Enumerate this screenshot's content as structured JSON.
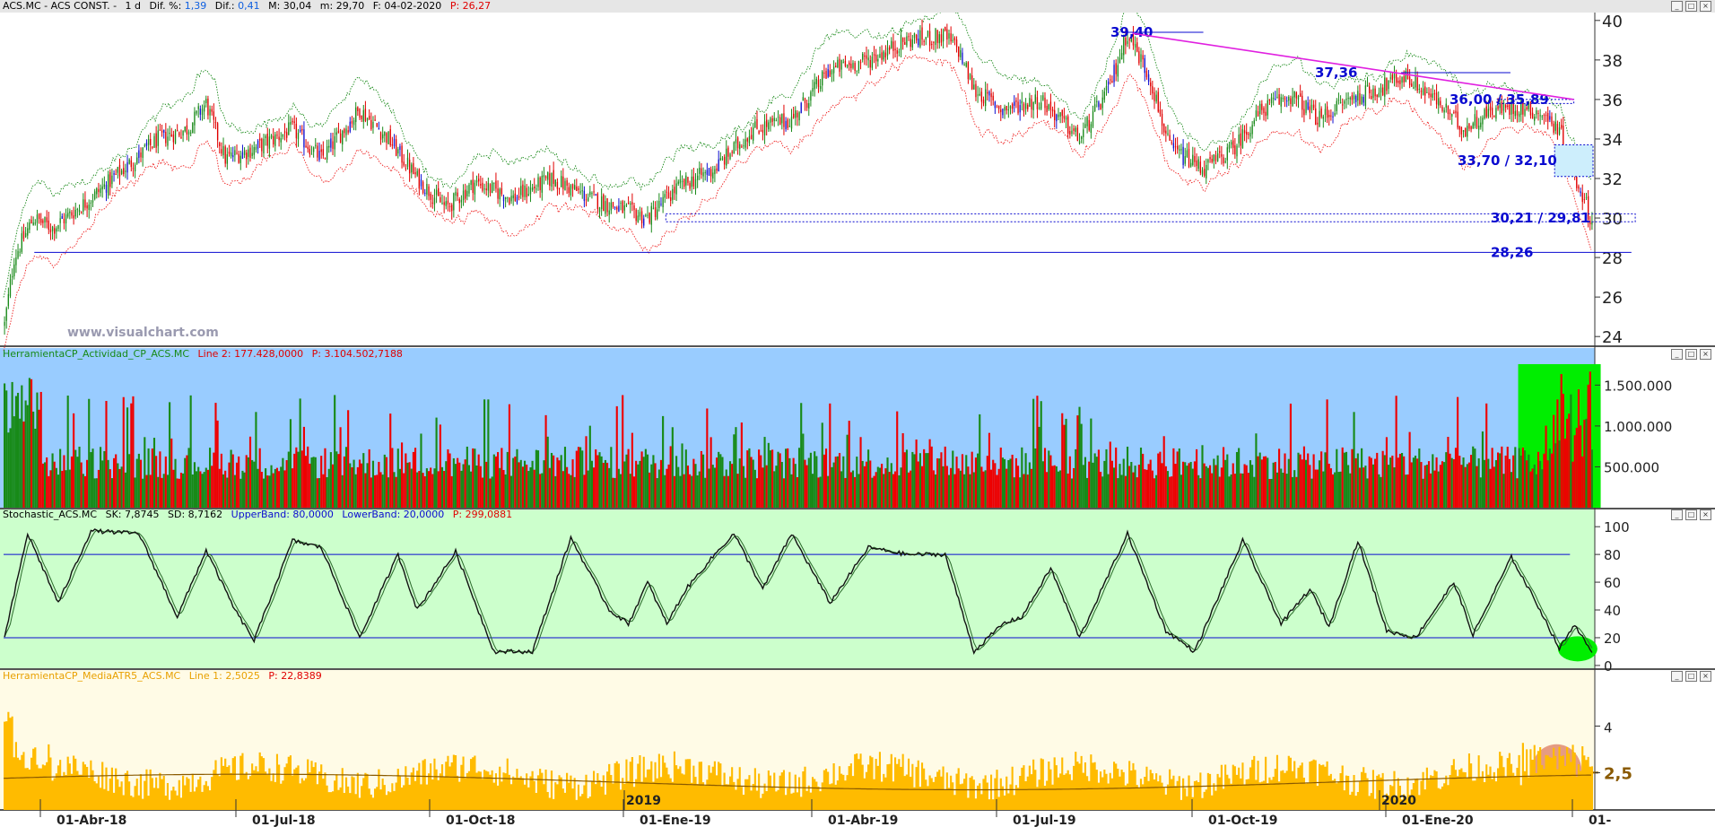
{
  "colors": {
    "bull": "#1a8a1a",
    "bear": "#e00000",
    "blue_candle": "#1010d0",
    "upper_band": "#1a8a1a",
    "lower_band": "#ee2020",
    "trendline": "#e020e0",
    "level": "#0a0ad0",
    "vol_bg": "#99ccff",
    "vol_green": "#178a17",
    "vol_red": "#ee0000",
    "highlight_green": "#00ee00",
    "stoch_bg": "#ccffcc",
    "atr_bg": "#fffbe6",
    "atr_fill": "#ffbb00"
  },
  "price_panel": {
    "header": {
      "symbol": "ACS.MC - ACS CONST. -",
      "period": "1 d",
      "dif_pct_label": "Dif. %:",
      "dif_pct": "1,39",
      "dif_label": "Dif.:",
      "dif": "0,41",
      "m": "M: 30,04",
      "mn": "m: 29,70",
      "f": "F: 04-02-2020",
      "p": "P: 26,27"
    },
    "watermark": "www.visualchart.com",
    "annotations": [
      {
        "id": "level-3940",
        "text": "39,40"
      },
      {
        "id": "level-3736",
        "text": "37,36"
      },
      {
        "id": "level-3600",
        "text": "36,00 / 35,89"
      },
      {
        "id": "level-3370",
        "text": "33,70 / 32,10"
      },
      {
        "id": "level-3021",
        "text": "30,21 / 29,81"
      },
      {
        "id": "level-2826",
        "text": "28,26"
      }
    ]
  },
  "volume_panel": {
    "header": {
      "name": "HerramientaCP_Actividad_CP_ACS.MC",
      "line": "Line 2: 177.428,0000",
      "p": "P: 3.104.502,7188"
    }
  },
  "stoch_panel": {
    "header": {
      "name": "Stochastic_ACS.MC",
      "sk": "SK: 7,8745",
      "sd": "SD: 8,7162",
      "upper": "UpperBand: 80,0000",
      "lower": "LowerBand: 20,0000",
      "p": "P: 299,0881"
    }
  },
  "atr_panel": {
    "header": {
      "name": "HerramientaCP_MediaATR5_ACS.MC",
      "line": "Line 1: 2,5025",
      "p": "P: 22,8389"
    }
  },
  "xaxis": {
    "labels": [
      "01-Abr-18",
      "01-Jul-18",
      "01-Oct-18",
      "01-Ene-19",
      "01-Abr-19",
      "01-Jul-19",
      "01-Oct-19",
      "01-Ene-20",
      "01-"
    ],
    "year_labels": [
      "2019",
      "2020"
    ]
  },
  "chart_data": [
    {
      "type": "candlestick",
      "id": "price",
      "y_ticks": [
        24,
        26,
        28,
        30,
        32,
        34,
        36,
        38,
        40
      ],
      "ylim": [
        23.6,
        40.4
      ],
      "horizontal_levels": [
        39.4,
        37.36,
        36.0,
        35.89,
        33.7,
        32.1,
        30.21,
        29.81,
        28.26
      ],
      "close_anchors": [
        [
          0,
          24.6
        ],
        [
          5,
          28
        ],
        [
          15,
          30
        ],
        [
          25,
          29.5
        ],
        [
          45,
          31
        ],
        [
          60,
          32.3
        ],
        [
          80,
          34
        ],
        [
          95,
          34.5
        ],
        [
          105,
          35.8
        ],
        [
          115,
          33
        ],
        [
          130,
          33.5
        ],
        [
          150,
          34.5
        ],
        [
          165,
          33
        ],
        [
          185,
          35.5
        ],
        [
          200,
          34
        ],
        [
          215,
          32
        ],
        [
          230,
          30.5
        ],
        [
          245,
          31.8
        ],
        [
          265,
          31
        ],
        [
          285,
          32
        ],
        [
          305,
          31
        ],
        [
          320,
          30.5
        ],
        [
          335,
          30
        ],
        [
          350,
          31.5
        ],
        [
          370,
          32.5
        ],
        [
          390,
          34.5
        ],
        [
          410,
          35
        ],
        [
          430,
          37.5
        ],
        [
          450,
          38
        ],
        [
          470,
          39
        ],
        [
          490,
          39.2
        ],
        [
          497,
          38.5
        ],
        [
          505,
          36.5
        ],
        [
          520,
          35.5
        ],
        [
          540,
          36
        ],
        [
          560,
          34
        ],
        [
          575,
          36.5
        ],
        [
          585,
          39.4
        ],
        [
          597,
          37
        ],
        [
          607,
          33.5
        ],
        [
          625,
          32.5
        ],
        [
          640,
          33.5
        ],
        [
          655,
          35.5
        ],
        [
          670,
          36.2
        ],
        [
          685,
          35
        ],
        [
          700,
          36
        ],
        [
          715,
          36.5
        ],
        [
          730,
          37.2
        ],
        [
          745,
          36
        ],
        [
          760,
          34.5
        ],
        [
          775,
          35.5
        ],
        [
          790,
          35.6
        ],
        [
          800,
          35.3
        ],
        [
          810,
          34.5
        ],
        [
          816,
          32.5
        ],
        [
          822,
          31.2
        ],
        [
          827,
          29.8
        ]
      ],
      "last_close": 29.81
    },
    {
      "type": "bar",
      "id": "volume",
      "y_ticks": [
        500000,
        1000000,
        1500000
      ],
      "y_tick_labels": [
        "500.000",
        "1.000.000",
        "1.500.000"
      ],
      "ylim": [
        0,
        1800000
      ]
    },
    {
      "type": "line",
      "id": "stochastic",
      "y_ticks": [
        0,
        20,
        40,
        60,
        80,
        100
      ],
      "ylim": [
        -2,
        104
      ],
      "bands": [
        20,
        80
      ],
      "anchors": [
        [
          0,
          20
        ],
        [
          12,
          95
        ],
        [
          28,
          45
        ],
        [
          45,
          97
        ],
        [
          70,
          95
        ],
        [
          90,
          35
        ],
        [
          105,
          83
        ],
        [
          120,
          40
        ],
        [
          130,
          18
        ],
        [
          150,
          90
        ],
        [
          165,
          85
        ],
        [
          185,
          20
        ],
        [
          205,
          80
        ],
        [
          215,
          40
        ],
        [
          235,
          82
        ],
        [
          255,
          10
        ],
        [
          275,
          10
        ],
        [
          295,
          92
        ],
        [
          315,
          40
        ],
        [
          325,
          30
        ],
        [
          335,
          60
        ],
        [
          345,
          30
        ],
        [
          355,
          55
        ],
        [
          370,
          80
        ],
        [
          380,
          95
        ],
        [
          395,
          55
        ],
        [
          410,
          95
        ],
        [
          430,
          45
        ],
        [
          450,
          85
        ],
        [
          470,
          80
        ],
        [
          490,
          80
        ],
        [
          505,
          10
        ],
        [
          520,
          30
        ],
        [
          530,
          35
        ],
        [
          545,
          70
        ],
        [
          560,
          20
        ],
        [
          585,
          95
        ],
        [
          605,
          25
        ],
        [
          620,
          10
        ],
        [
          645,
          90
        ],
        [
          665,
          30
        ],
        [
          680,
          55
        ],
        [
          690,
          28
        ],
        [
          705,
          90
        ],
        [
          720,
          25
        ],
        [
          735,
          20
        ],
        [
          755,
          60
        ],
        [
          765,
          22
        ],
        [
          785,
          78
        ],
        [
          800,
          40
        ],
        [
          810,
          12
        ],
        [
          818,
          30
        ],
        [
          827,
          8
        ]
      ]
    },
    {
      "type": "area",
      "id": "atr",
      "y_ticks": [
        2.5,
        4
      ],
      "y_tick_labels": [
        "2,5",
        "4"
      ],
      "ylim": [
        1.3,
        5.4
      ],
      "last_value": 2.5025
    }
  ]
}
